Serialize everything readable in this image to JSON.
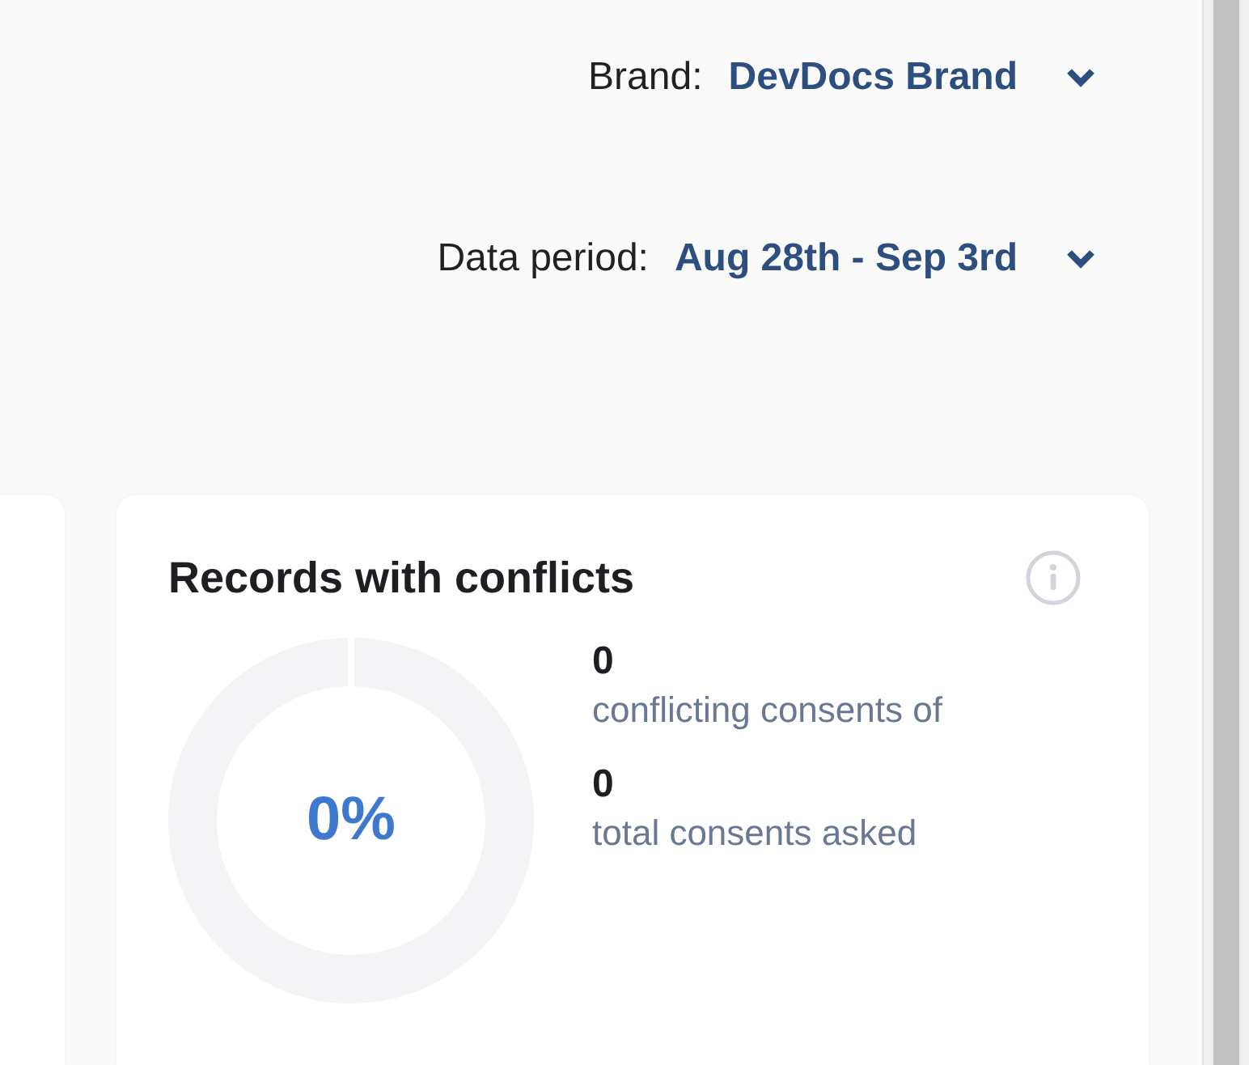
{
  "filters": [
    {
      "label": "Brand:",
      "value": "DevDocs Brand"
    },
    {
      "label": "Data period:",
      "value": "Aug 28th - Sep 3rd"
    }
  ],
  "card": {
    "title": "Records with conflicts",
    "percent": "0%",
    "stats": [
      {
        "value": "0",
        "caption": "conflicting consents of"
      },
      {
        "value": "0",
        "caption": "total consents asked"
      }
    ]
  }
}
